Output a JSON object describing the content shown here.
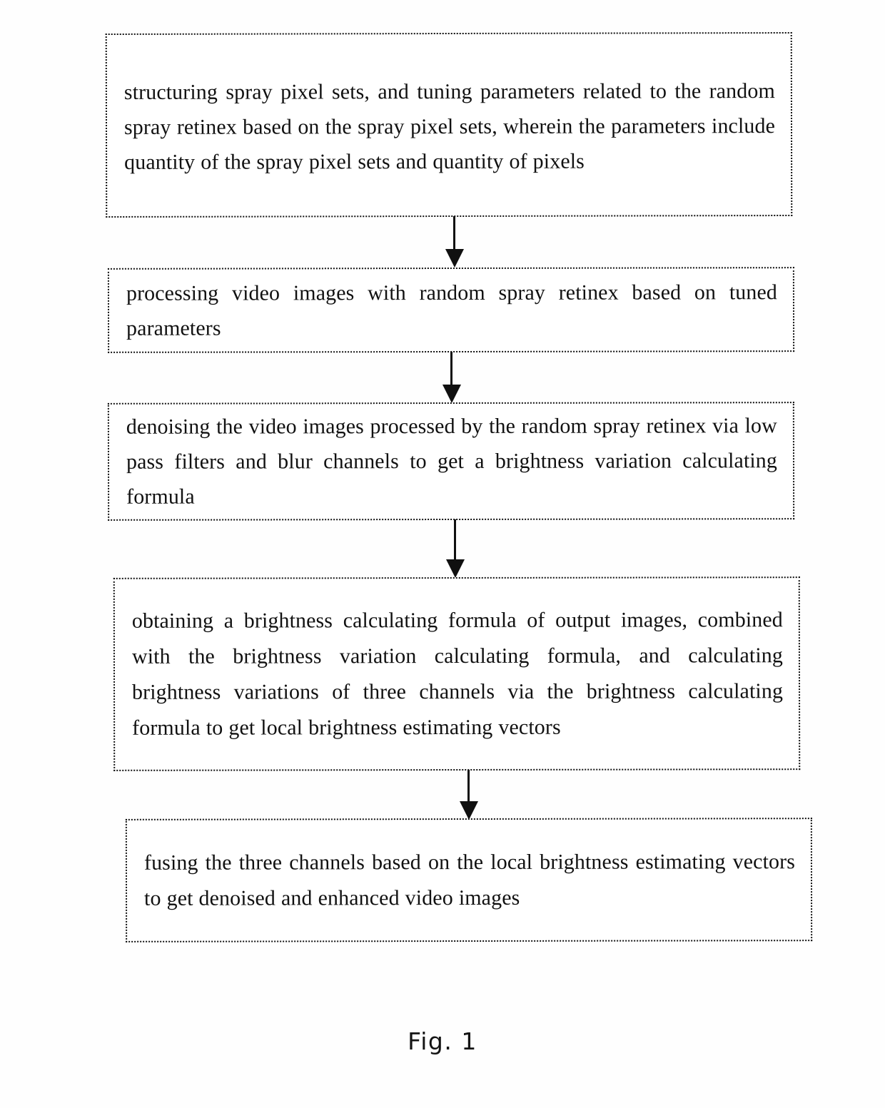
{
  "figure": {
    "caption": "Fig. 1"
  },
  "flowchart": {
    "type": "flowchart",
    "orientation": "vertical",
    "border_style": "dotted",
    "border_color": "#111111",
    "background_color": "#ffffff",
    "text_color": "#111111",
    "nodes": [
      {
        "id": "step-1",
        "text": "structuring spray pixel sets, and tuning parameters related to the random spray retinex based on the spray pixel sets, wherein the parameters include quantity of the spray pixel sets and quantity of pixels"
      },
      {
        "id": "step-2",
        "text": "processing video images with random spray retinex based on tuned parameters"
      },
      {
        "id": "step-3",
        "text": "denoising the video images processed by the random spray retinex via low pass filters and blur channels to get a brightness variation calculating formula"
      },
      {
        "id": "step-4",
        "text": "obtaining a brightness calculating formula of output images, combined with the brightness variation calculating formula, and calculating brightness variations of three channels via the brightness calculating formula to get local brightness estimating vectors"
      },
      {
        "id": "step-5",
        "text": "fusing the three channels based on the local brightness estimating vectors to get denoised and enhanced video images"
      }
    ],
    "connectors": [
      {
        "id": "arrow-1",
        "from": "step-1",
        "to": "step-2",
        "direction": "down"
      },
      {
        "id": "arrow-2",
        "from": "step-2",
        "to": "step-3",
        "direction": "down"
      },
      {
        "id": "arrow-3",
        "from": "step-3",
        "to": "step-4",
        "direction": "down"
      },
      {
        "id": "arrow-4",
        "from": "step-4",
        "to": "step-5",
        "direction": "down"
      }
    ]
  }
}
